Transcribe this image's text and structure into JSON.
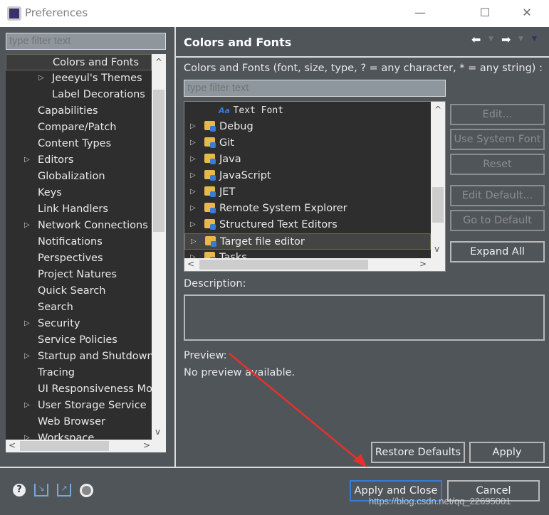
{
  "window": {
    "title": "Preferences",
    "minimize": "—",
    "maximize": "☐",
    "close": "✕"
  },
  "left": {
    "filter_placeholder": "type filter text",
    "items": [
      {
        "label": "Colors and Fonts",
        "level": 2,
        "arrow": false,
        "selected": true
      },
      {
        "label": "Jeeeyul's Themes",
        "level": 2,
        "arrow": true
      },
      {
        "label": "Label Decorations",
        "level": 2,
        "arrow": false
      },
      {
        "label": "Capabilities",
        "level": 1,
        "arrow": false
      },
      {
        "label": "Compare/Patch",
        "level": 1,
        "arrow": false
      },
      {
        "label": "Content Types",
        "level": 1,
        "arrow": false
      },
      {
        "label": "Editors",
        "level": 1,
        "arrow": true
      },
      {
        "label": "Globalization",
        "level": 1,
        "arrow": false
      },
      {
        "label": "Keys",
        "level": 1,
        "arrow": false
      },
      {
        "label": "Link Handlers",
        "level": 1,
        "arrow": false
      },
      {
        "label": "Network Connections",
        "level": 1,
        "arrow": true
      },
      {
        "label": "Notifications",
        "level": 1,
        "arrow": false
      },
      {
        "label": "Perspectives",
        "level": 1,
        "arrow": false
      },
      {
        "label": "Project Natures",
        "level": 1,
        "arrow": false
      },
      {
        "label": "Quick Search",
        "level": 1,
        "arrow": false
      },
      {
        "label": "Search",
        "level": 1,
        "arrow": false
      },
      {
        "label": "Security",
        "level": 1,
        "arrow": true
      },
      {
        "label": "Service Policies",
        "level": 1,
        "arrow": false
      },
      {
        "label": "Startup and Shutdown",
        "level": 1,
        "arrow": true
      },
      {
        "label": "Tracing",
        "level": 1,
        "arrow": false
      },
      {
        "label": "UI Responsiveness Mo",
        "level": 1,
        "arrow": false
      },
      {
        "label": "User Storage Service",
        "level": 1,
        "arrow": true
      },
      {
        "label": "Web Browser",
        "level": 1,
        "arrow": false
      },
      {
        "label": "Workspace",
        "level": 1,
        "arrow": true
      }
    ]
  },
  "right": {
    "title": "Colors and Fonts",
    "description_label": "Colors and Fonts (font, size, type, ? = any character, * = any string) :",
    "filter_placeholder": "type filter text",
    "font_item": {
      "icon": "Aa",
      "label": "Text  Font"
    },
    "items": [
      "Debug",
      "Git",
      "Java",
      "JavaScript",
      "JET",
      "Remote System Explorer",
      "Structured Text Editors",
      "Target file editor",
      "Tasks"
    ],
    "selected": "Target file editor",
    "buttons": {
      "edit": "Edit...",
      "use_system_font": "Use System Font",
      "reset": "Reset",
      "edit_default": "Edit Default...",
      "go_to_default": "Go to Default",
      "expand_all": "Expand All"
    },
    "description": "Description:",
    "preview": "Preview:",
    "preview_text": "No preview available.",
    "restore_defaults": "Restore Defaults",
    "apply": "Apply"
  },
  "footer": {
    "apply_and_close": "Apply and Close",
    "cancel": "Cancel",
    "watermark": "https://blog.csdn.net/qq_22695001"
  },
  "colors": {
    "background": "#50555a",
    "tree": "#2e2e2e",
    "accent": "#3a7bd5",
    "arrow": "#e8302a"
  }
}
